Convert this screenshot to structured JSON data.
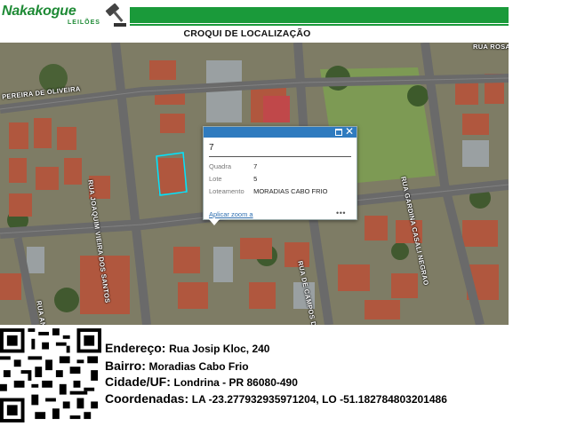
{
  "brand": {
    "name": "Nakakogue",
    "sub": "LEILÕES",
    "accent_color": "#1a9a3a",
    "logo_icon": "gavel-icon"
  },
  "page": {
    "title": "CROQUI DE LOCALIZAÇÃO"
  },
  "map": {
    "street_labels": [
      "PEREIRA DE OLIVEIRA",
      "RUA JOAQUIM VIEIRA DOS SANTOS",
      "RUA GARDINA CASALI NEGRAO",
      "RUA ANTONIO NOI",
      "RUA DE CAMPOS DOS GOIOERE",
      "RUA ROSA"
    ]
  },
  "popup": {
    "title": "7",
    "fields": [
      {
        "label": "Quadra",
        "value": "7"
      },
      {
        "label": "Lote",
        "value": "5"
      },
      {
        "label": "Loteamento",
        "value": "MORADIAS CABO FRIO"
      }
    ],
    "zoom_link": "Aplicar zoom a",
    "more": "•••",
    "header_color": "#2f7bbf"
  },
  "info": {
    "endereco_label": "Endereço:",
    "endereco_value": "Rua Josip Kloc, 240",
    "bairro_label": "Bairro:",
    "bairro_value": "Moradias Cabo Frio",
    "cidade_label": "Cidade/UF:",
    "cidade_value": "Londrina - PR 86080-490",
    "coord_label": "Coordenadas:",
    "coord_value": "LA -23.277932935971204, LO -51.182784803201486"
  }
}
